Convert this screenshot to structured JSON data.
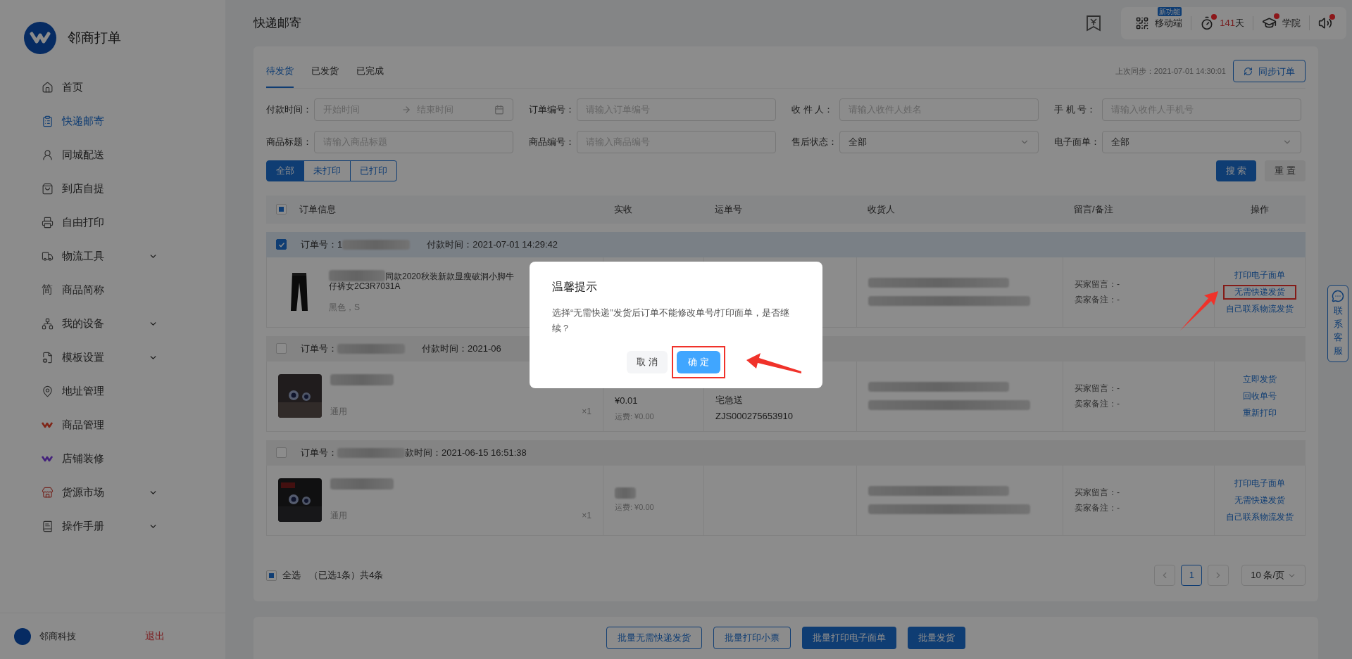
{
  "app": {
    "name": "邻商打单"
  },
  "sidebar": {
    "items": [
      {
        "label": "首页",
        "selected": false,
        "expandable": false
      },
      {
        "label": "快递邮寄",
        "selected": true,
        "expandable": false
      },
      {
        "label": "同城配送",
        "selected": false,
        "expandable": false
      },
      {
        "label": "到店自提",
        "selected": false,
        "expandable": false
      },
      {
        "label": "自由打印",
        "selected": false,
        "expandable": false
      },
      {
        "label": "物流工具",
        "selected": false,
        "expandable": true
      },
      {
        "glyph": "简",
        "label": "商品简称",
        "selected": false,
        "expandable": false
      },
      {
        "label": "我的设备",
        "selected": false,
        "expandable": true
      },
      {
        "label": "模板设置",
        "selected": false,
        "expandable": true
      },
      {
        "label": "地址管理",
        "selected": false,
        "expandable": false
      },
      {
        "label": "商品管理",
        "selected": false,
        "expandable": false
      },
      {
        "label": "店铺装修",
        "selected": false,
        "expandable": false
      },
      {
        "label": "货源市场",
        "selected": false,
        "expandable": true
      },
      {
        "label": "操作手册",
        "selected": false,
        "expandable": true
      }
    ],
    "user": {
      "name": "邻商科技",
      "logout": "退出"
    }
  },
  "header": {
    "title": "快递邮寄",
    "toolbar": [
      {
        "kind": "mobile",
        "badge": "新功能",
        "label": "移动端"
      },
      {
        "kind": "days",
        "value": "141",
        "unit": "天",
        "dot": true
      },
      {
        "kind": "academy",
        "label": "学院",
        "dot": true
      },
      {
        "kind": "sound",
        "dot": true
      }
    ]
  },
  "tabs": [
    {
      "label": "待发货",
      "selected": true
    },
    {
      "label": "已发货",
      "selected": false
    },
    {
      "label": "已完成",
      "selected": false
    }
  ],
  "sync": {
    "text": "上次同步：2021-07-01 14:30:01",
    "button": "同步订单"
  },
  "filters": [
    {
      "kind": "daterange",
      "label": "付款时间：",
      "start": "开始时间",
      "end": "结束时间"
    },
    {
      "kind": "text",
      "label": "订单编号：",
      "placeholder": "请输入订单编号"
    },
    {
      "kind": "text",
      "label": "收 件 人：",
      "placeholder": "请输入收件人姓名"
    },
    {
      "kind": "text",
      "label": "手 机 号：",
      "placeholder": "请输入收件人手机号"
    },
    {
      "kind": "text",
      "label": "商品标题：",
      "placeholder": "请输入商品标题"
    },
    {
      "kind": "text",
      "label": "商品编号：",
      "placeholder": "请输入商品编号"
    },
    {
      "kind": "select",
      "label": "售后状态：",
      "value": "全部"
    },
    {
      "kind": "select",
      "label": "电子面单：",
      "value": "全部"
    }
  ],
  "print_filter": [
    {
      "label": "全部",
      "selected": true
    },
    {
      "label": "未打印",
      "selected": false
    },
    {
      "label": "已打印",
      "selected": false
    }
  ],
  "search_button": "搜 索",
  "reset_button": "重 置",
  "table": {
    "columns": [
      "订单信息",
      "实收",
      "运单号",
      "收货人",
      "留言/备注",
      "操作"
    ],
    "select_all_indeterminate": true
  },
  "orders": [
    {
      "checked": true,
      "order_label": "订单号：1",
      "paid_time": "付款时间：2021-07-01 14:29:42",
      "title": "同款2020秋装新款显瘦破洞小脚牛",
      "title_line2": "仔裤女2C3R7031A",
      "spec": "黑色，S",
      "remarks": [
        "买家留言：-",
        "卖家备注：-"
      ],
      "actions": [
        {
          "label": "打印电子面单",
          "highlighted": false
        },
        {
          "label": "无需快递发货",
          "highlighted": true
        },
        {
          "label": "自己联系物流发货",
          "highlighted": false
        }
      ]
    },
    {
      "checked": false,
      "order_label": "订单号：",
      "paid_time": "付款时间：2021-06",
      "spec": "通用",
      "qty": "×1",
      "amount": "¥0.01",
      "freight": "运费: ¥0.00",
      "waybill": [
        "宅急送",
        "ZJS000275653910"
      ],
      "remarks": [
        "买家留言：-",
        "卖家备注：-"
      ],
      "actions": [
        {
          "label": "立即发货",
          "highlighted": false
        },
        {
          "label": "回收单号",
          "highlighted": false
        },
        {
          "label": "重新打印",
          "highlighted": false
        }
      ]
    },
    {
      "checked": false,
      "order_label": "订单号：",
      "paid_time": "款时间：2021-06-15 16:51:38",
      "spec": "通用",
      "qty": "×1",
      "freight": "运费: ¥0.00",
      "remarks": [
        "买家留言：-",
        "卖家备注：-"
      ],
      "actions": [
        {
          "label": "打印电子面单",
          "highlighted": false
        },
        {
          "label": "无需快递发货",
          "highlighted": false
        },
        {
          "label": "自己联系物流发货",
          "highlighted": false
        }
      ]
    }
  ],
  "footer": {
    "select_all_indeterminate": true,
    "select_all": "全选",
    "selected": "（已选1条）",
    "total": "共4条"
  },
  "pagination": {
    "pages": [
      {
        "label": "1",
        "selected": true
      }
    ],
    "page_size": "10 条/页"
  },
  "bulk_actions": [
    {
      "label": "批量无需快递发货",
      "kind": "outline"
    },
    {
      "label": "批量打印小票",
      "kind": "outline"
    },
    {
      "label": "批量打印电子面单",
      "kind": "solid"
    },
    {
      "label": "批量发货",
      "kind": "solid"
    }
  ],
  "contact": {
    "label": "联系客服"
  },
  "modal": {
    "title": "温馨提示",
    "message": "选择“无需快递”发货后订单不能修改单号/打印面单，是否继续？",
    "cancel": "取 消",
    "confirm": "确 定",
    "confirm_highlighted": true
  }
}
